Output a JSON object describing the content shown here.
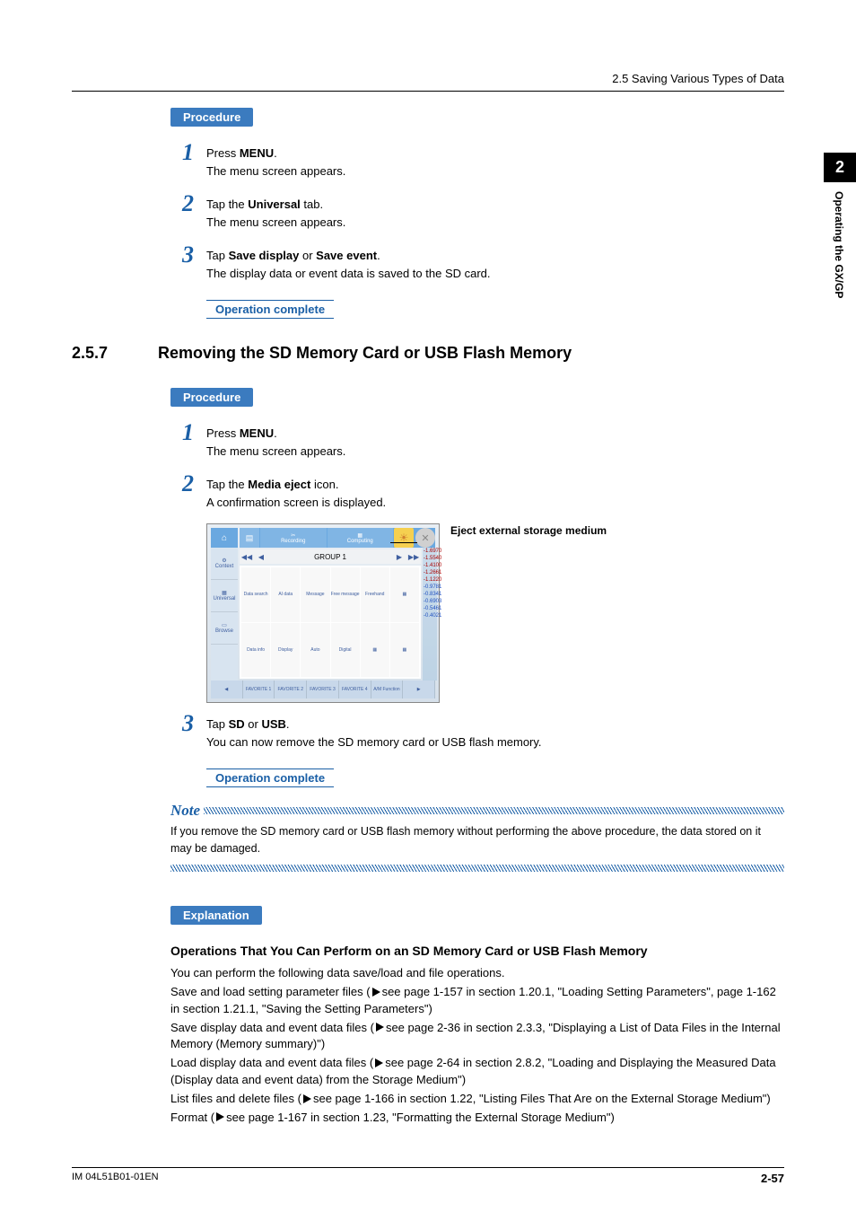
{
  "header": {
    "breadcrumb": "2.5  Saving Various Types of Data"
  },
  "sidetab": {
    "num": "2",
    "text": "Operating the GX/GP"
  },
  "proc1": {
    "label": "Procedure",
    "steps": {
      "s1a": "Press ",
      "s1b": "MENU",
      "s1c": ".",
      "s1sub": "The menu screen appears.",
      "s2a": "Tap the ",
      "s2b": "Universal",
      "s2c": " tab.",
      "s2sub": "The menu screen appears.",
      "s3a": "Tap ",
      "s3b": "Save display",
      "s3c": " or ",
      "s3d": "Save event",
      "s3e": ".",
      "s3sub": "The display data or event data is saved to the SD card."
    },
    "complete": "Operation complete"
  },
  "heading": {
    "num": "2.5.7",
    "title": "Removing the SD Memory Card or USB Flash Memory"
  },
  "proc2": {
    "label": "Procedure",
    "steps": {
      "s1a": "Press ",
      "s1b": "MENU",
      "s1c": ".",
      "s1sub": "The menu screen appears.",
      "s2a": "Tap the ",
      "s2b": "Media eject",
      "s2c": " icon.",
      "s2sub": "A confirmation screen is displayed.",
      "s3a": "Tap ",
      "s3b": "SD",
      "s3c": " or ",
      "s3d": "USB",
      "s3e": ".",
      "s3sub": "You can now remove the SD memory card or USB flash memory."
    },
    "complete": "Operation complete",
    "caption": "Eject external storage medium"
  },
  "screenshot": {
    "recording": "Recording",
    "computing": "Computing",
    "group": "GROUP 1",
    "side": {
      "context": "Context",
      "universal": "Universal",
      "browse": "Browse"
    },
    "vals": {
      "v1": "-1.6970",
      "v2": "-1.5540",
      "v3": "-1.4100",
      "v4": "-1.2661",
      "v5": "-1.1220",
      "v6": "-0.9781",
      "v7": "-0.8341",
      "v8": "-0.6903",
      "v9": "-0.5461",
      "v10": "-0.4021"
    },
    "favs": {
      "f1": "FAVORITE 1",
      "f2": "FAVORITE 2",
      "f3": "FAVORITE 3",
      "f4": "FAVORITE 4",
      "f5": "A/M Function"
    }
  },
  "note": {
    "label": "Note",
    "text": "If you remove the SD memory card or USB flash memory without performing the above procedure, the data stored on it may be damaged."
  },
  "explanation": {
    "label": "Explanation",
    "subheading": "Operations That You Can Perform on an SD Memory Card or USB Flash Memory",
    "intro": "You can perform the following data save/load and file operations.",
    "l1a": "Save and load setting parameter files (",
    "l1b": "see page 1-157 in section 1.20.1, \"Loading Setting Parameters\", page 1-162 in section 1.21.1, \"Saving the Setting Parameters\")",
    "l2a": "Save display data and event data files (",
    "l2b": "see page 2-36 in section 2.3.3, \"Displaying a List of Data Files in the Internal Memory (Memory summary)\")",
    "l3a": "Load display data and event data files (",
    "l3b": "see page 2-64 in section 2.8.2, \"Loading and Displaying the Measured Data (Display data and event data) from the Storage Medium\")",
    "l4a": "List files and delete files (",
    "l4b": "see page 1-166 in section 1.22, \"Listing Files That Are on the External Storage Medium\")",
    "l5a": "Format (",
    "l5b": "see page 1-167 in section 1.23, \"Formatting the External Storage Medium\")"
  },
  "footer": {
    "doc": "IM 04L51B01-01EN",
    "page": "2-57"
  }
}
